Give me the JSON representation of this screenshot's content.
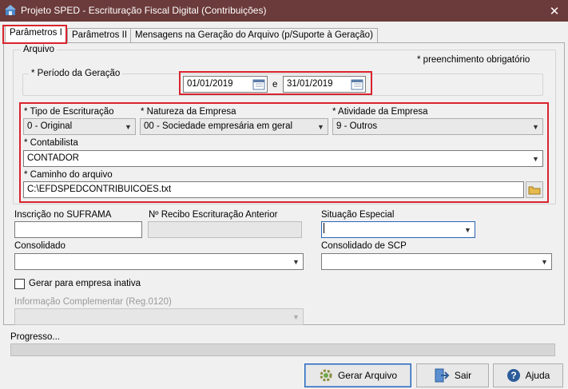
{
  "window": {
    "title": "Projeto SPED - Escrituração Fiscal Digital (Contribuições)",
    "close_glyph": "✕"
  },
  "tabs": [
    {
      "label": "Parâmetros I"
    },
    {
      "label": "Parâmetros II"
    },
    {
      "label": "Mensagens na Geração do Arquivo (p/Suporte à Geração)"
    }
  ],
  "arquivo": {
    "group_label": "Arquivo",
    "required_note": "* preenchimento obrigatório",
    "periodo_label": "* Período da Geração",
    "date_start": "01/01/2019",
    "date_sep": "e",
    "date_end": "31/01/2019",
    "tipo_label": "* Tipo de Escrituração",
    "tipo_value": "0 - Original",
    "natureza_label": "* Natureza da Empresa",
    "natureza_value": "00 - Sociedade empresária em geral",
    "atividade_label": "* Atividade da Empresa",
    "atividade_value": "9 - Outros",
    "contabilista_label": "* Contabilista",
    "contabilista_value": "CONTADOR",
    "caminho_label": "* Caminho do arquivo",
    "caminho_value": "C:\\EFDSPEDCONTRIBUICOES.txt"
  },
  "form": {
    "suframa_label": "Inscrição no SUFRAMA",
    "suframa_value": "",
    "recibo_label": "Nº Recibo Escrituração Anterior",
    "recibo_value": "",
    "situacao_label": "Situação Especial",
    "situacao_value": "",
    "consolidado_label": "Consolidado",
    "consolidado_value": "",
    "consolidado_scp_label": "Consolidado de SCP",
    "consolidado_scp_value": "",
    "inativa_label": "Gerar para empresa inativa",
    "inativa_checked": false,
    "info_comp_label": "Informação Complementar (Reg.0120)",
    "info_comp_value": ""
  },
  "progress": {
    "label": "Progresso...",
    "value": 0
  },
  "buttons": {
    "gerar": "Gerar Arquivo",
    "sair": "Sair",
    "ajuda": "Ajuda"
  },
  "colors": {
    "titlebar": "#6b3a3a",
    "highlight": "#d9232e"
  }
}
